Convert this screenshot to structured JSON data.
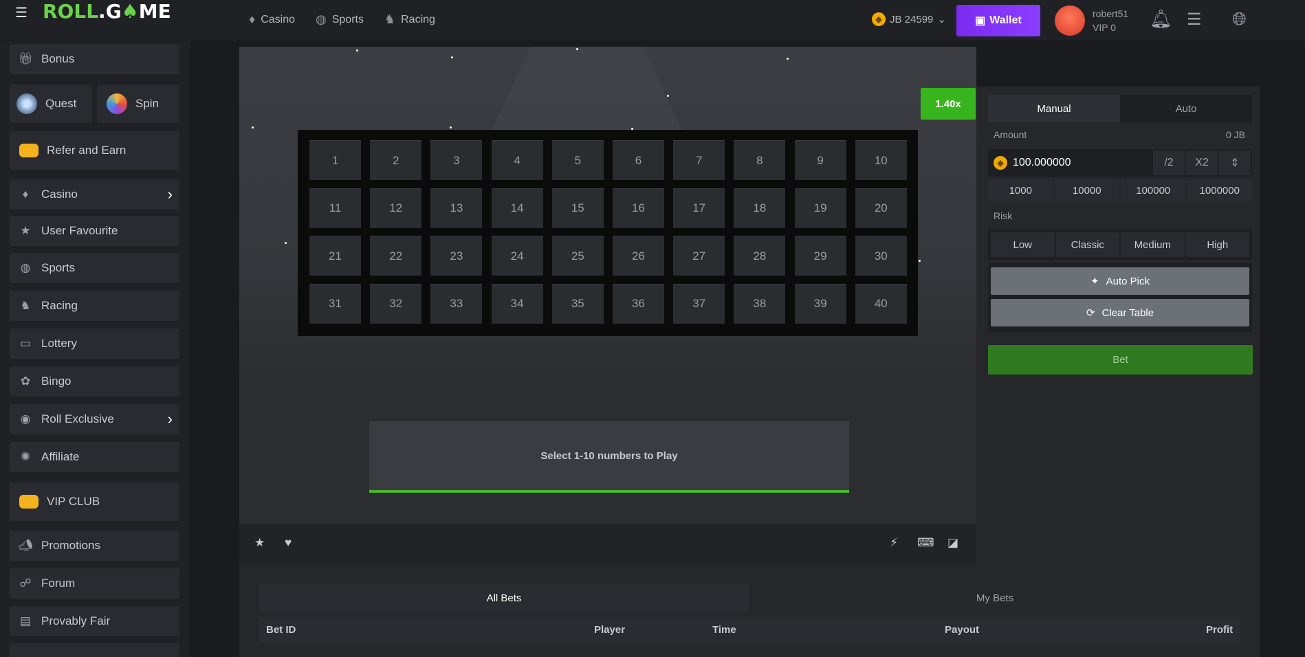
{
  "header": {
    "logo_left": "ROLL",
    "logo_dot": ".",
    "logo_right": "G",
    "logo_tail": "ME",
    "nav": [
      {
        "label": "Casino",
        "icon": "casino-icon"
      },
      {
        "label": "Sports",
        "icon": "sports-icon"
      },
      {
        "label": "Racing",
        "icon": "racing-icon"
      }
    ],
    "balance": "JB 24599",
    "wallet_label": "Wallet",
    "username": "robert51",
    "vip": "VIP 0"
  },
  "sidebar": {
    "bonus": "Bonus",
    "quest": "Quest",
    "spin": "Spin",
    "refer": "Refer and Earn",
    "items": [
      {
        "label": "Casino",
        "icon": "casino-icon",
        "chevron": true
      },
      {
        "label": "User Favourite",
        "icon": "star-icon"
      },
      {
        "label": "Sports",
        "icon": "sports-icon"
      },
      {
        "label": "Racing",
        "icon": "racing-icon"
      },
      {
        "label": "Lottery",
        "icon": "lottery-icon"
      },
      {
        "label": "Bingo",
        "icon": "bingo-icon"
      },
      {
        "label": "Roll Exclusive",
        "icon": "exclusive-icon",
        "chevron": true
      },
      {
        "label": "Affiliate",
        "icon": "affiliate-icon"
      }
    ],
    "vip_club": "VIP CLUB",
    "bottom": [
      {
        "label": "Promotions",
        "icon": "megaphone-icon"
      },
      {
        "label": "Forum",
        "icon": "forum-icon"
      },
      {
        "label": "Provably Fair",
        "icon": "fair-icon"
      }
    ]
  },
  "game": {
    "multiplier": "1.40x",
    "numbers": [
      "1",
      "2",
      "3",
      "4",
      "5",
      "6",
      "7",
      "8",
      "9",
      "10",
      "11",
      "12",
      "13",
      "14",
      "15",
      "16",
      "17",
      "18",
      "19",
      "20",
      "21",
      "22",
      "23",
      "24",
      "25",
      "26",
      "27",
      "28",
      "29",
      "30",
      "31",
      "32",
      "33",
      "34",
      "35",
      "36",
      "37",
      "38",
      "39",
      "40"
    ],
    "hint": "Select 1-10 numbers to Play"
  },
  "panel": {
    "tabs": [
      "Manual",
      "Auto"
    ],
    "amount_label": "Amount",
    "amount_unit": "0 JB",
    "amount_value": "100.000000",
    "half": "/2",
    "double": "X2",
    "quick": [
      "1000",
      "10000",
      "100000",
      "1000000"
    ],
    "risk_label": "Risk",
    "risk": [
      "Low",
      "Classic",
      "Medium",
      "High"
    ],
    "auto_pick": "Auto Pick",
    "clear_table": "Clear Table",
    "bet": "Bet"
  },
  "bets": {
    "tabs": [
      "All Bets",
      "My Bets"
    ],
    "columns": [
      "Bet ID",
      "Player",
      "Time",
      "Payout",
      "Profit"
    ]
  },
  "colors": {
    "accent_green": "#38b51c",
    "wallet_purple": "#7a2bf0",
    "bg": "#1a1b1e"
  }
}
